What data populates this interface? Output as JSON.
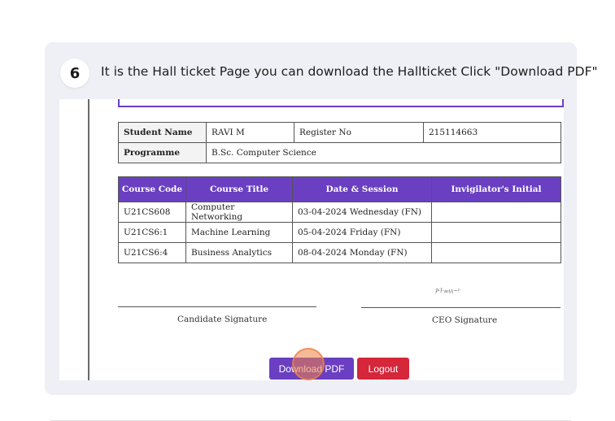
{
  "step": {
    "number": "6",
    "instruction": "It is the Hall ticket Page you can download the Hallticket Click \"Download PDF\""
  },
  "student": {
    "name_label": "Student Name",
    "name": "RAVI M",
    "register_label": "Register No",
    "register_no": "215114663",
    "programme_label": "Programme",
    "programme": "B.Sc. Computer Science"
  },
  "courses": {
    "headers": [
      "Course Code",
      "Course Title",
      "Date & Session",
      "Invigilator's Initial"
    ],
    "rows": [
      [
        "U21CS608",
        "Computer Networking",
        "03-04-2024 Wednesday (FN)",
        ""
      ],
      [
        "U21CS6:1",
        "Machine Learning",
        "05-04-2024 Friday (FN)",
        ""
      ],
      [
        "U21CS6:4",
        "Business Analytics",
        "08-04-2024 Monday (FN)",
        ""
      ]
    ]
  },
  "signatures": {
    "candidate": "Candidate Signature",
    "ceo": "CEO Signature"
  },
  "buttons": {
    "download": "Download PDF",
    "logout": "Logout"
  },
  "colors": {
    "accent": "#6a3fc1",
    "logout": "#d5263a",
    "click_marker": "#ee8246"
  }
}
